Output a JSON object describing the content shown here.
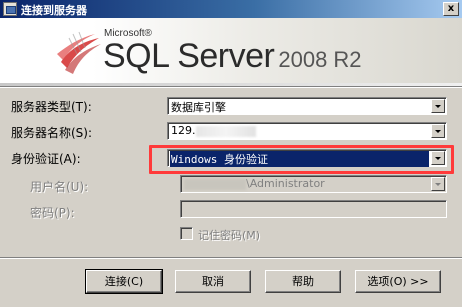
{
  "window": {
    "title": "连接到服务器",
    "close_symbol": "x"
  },
  "banner": {
    "brand": "Microsoft®",
    "product": "SQL Server",
    "version": "2008 R2"
  },
  "form": {
    "server_type": {
      "label": "服务器类型(T):",
      "value": "数据库引擎"
    },
    "server_name": {
      "label": "服务器名称(S):",
      "value": "129."
    },
    "auth": {
      "label": "身份验证(A):",
      "value": "Windows 身份验证"
    },
    "username": {
      "label": "用户名(U):",
      "value": "\\Administrator"
    },
    "password": {
      "label": "密码(P):",
      "value": ""
    },
    "remember": {
      "label": "记住密码(M)",
      "checked": false
    }
  },
  "buttons": {
    "connect": "连接(C)",
    "cancel": "取消",
    "help": "帮助",
    "options": "选项(O) >>"
  },
  "colors": {
    "title_bar": "#0a246a",
    "selection": "#0a246a",
    "highlight_box": "#ff3a3a",
    "dialog_bg": "#d4d0c8"
  }
}
